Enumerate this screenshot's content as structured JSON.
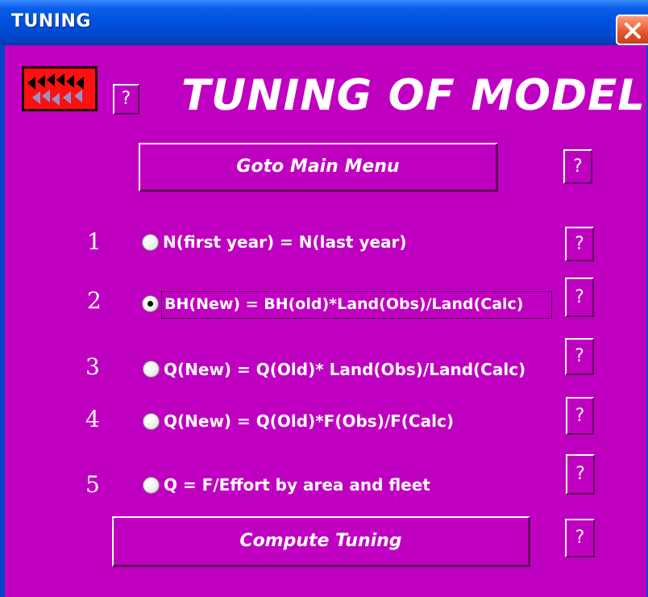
{
  "window": {
    "title": "TUNING"
  },
  "heading": "TUNING OF MODEL",
  "help_label": "?",
  "buttons": {
    "main_menu": "Goto Main Menu",
    "compute": "Compute Tuning"
  },
  "options": [
    {
      "number": "1",
      "label": "N(first year) = N(last year)",
      "selected": false
    },
    {
      "number": "2",
      "label": "BH(New) = BH(old)*Land(Obs)/Land(Calc)",
      "selected": true
    },
    {
      "number": "3",
      "label": "Q(New) = Q(Old)* Land(Obs)/Land(Calc)",
      "selected": false
    },
    {
      "number": "4",
      "label": "Q(New) = Q(Old)*F(Obs)/F(Calc)",
      "selected": false
    },
    {
      "number": "5",
      "label": "Q = F/Effort by area and fleet",
      "selected": false
    }
  ],
  "colors": {
    "background": "#c000c0",
    "titlebar": "#0050dd",
    "logo": "#ff1010",
    "text": "#ffffff"
  },
  "icons": {
    "logo": "arrows-logo-icon",
    "close": "close-icon",
    "help": "help-icon"
  }
}
